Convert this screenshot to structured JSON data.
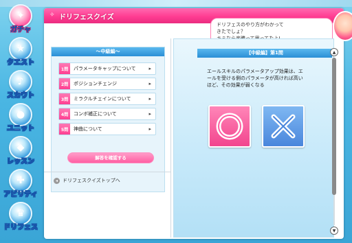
{
  "nav": [
    {
      "label": "ガチャ",
      "icon": "gacha-icon",
      "active": true
    },
    {
      "label": "クエスト",
      "icon": "quest-icon"
    },
    {
      "label": "スカウト",
      "icon": "scout-icon"
    },
    {
      "label": "ユニット",
      "icon": "unit-icon"
    },
    {
      "label": "レッスン",
      "icon": "lesson-icon"
    },
    {
      "label": "アビリティ",
      "icon": "ability-icon"
    },
    {
      "label": "ドリフェス",
      "icon": "drifes-icon"
    }
  ],
  "window": {
    "title": "ドリフェスクイズ",
    "accent": "#ff3d92"
  },
  "bubble": {
    "lines": [
      "ドリフェスのやり方がわかって",
      "きたでしょ？",
      "キミなら楽勝って思ってたよ!"
    ]
  },
  "left_panel": {
    "header": "～中級編～",
    "questions": [
      {
        "num": "1問",
        "label": "パラメータキャップについて"
      },
      {
        "num": "2問",
        "label": "ポジションチェンジ"
      },
      {
        "num": "3問",
        "label": "ミラクルチェインについて"
      },
      {
        "num": "4問",
        "label": "コンボ補正について"
      },
      {
        "num": "5問",
        "label": "神曲について"
      }
    ],
    "confirm_button": "解答を確認する",
    "back_link": "ドリフェスクイズトップへ"
  },
  "right_panel": {
    "header": "【中級編】第1問",
    "question_lines": [
      "エールスキルのパラメータアップ効果は、エ",
      "ールを受ける側のパラメータが高ければ高い",
      "ほど、その効果が弱くなる"
    ],
    "answer_true": "○",
    "answer_false": "×"
  }
}
